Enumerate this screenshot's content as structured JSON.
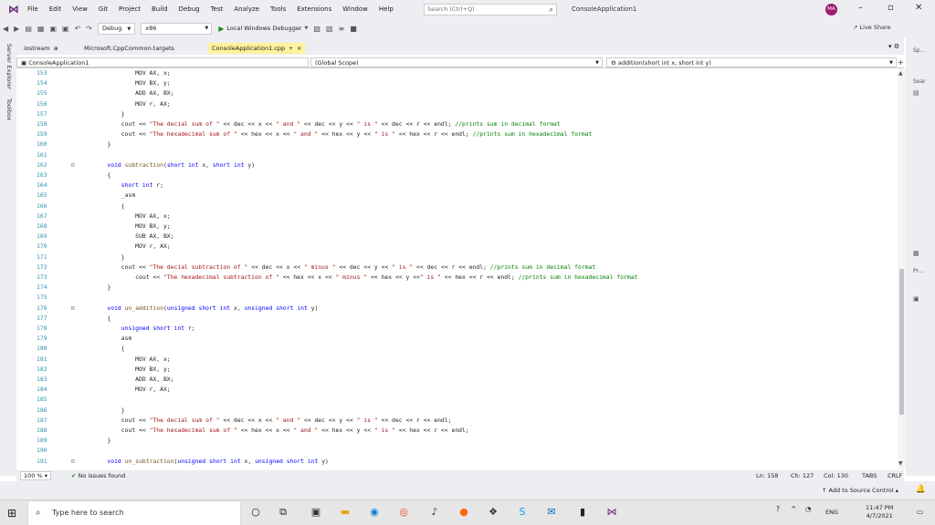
{
  "menu": [
    "File",
    "Edit",
    "View",
    "Git",
    "Project",
    "Build",
    "Debug",
    "Test",
    "Analyze",
    "Tools",
    "Extensions",
    "Window",
    "Help"
  ],
  "search": {
    "placeholder": "Search (Ctrl+Q)"
  },
  "solution_title": "ConsoleApplication1",
  "avatar": "MA",
  "toolbar": {
    "config": "Debug",
    "platform": "x86",
    "debugger": "Local Windows Debugger",
    "live_share": "Live Share"
  },
  "side_tabs": [
    "Server Explorer",
    "Toolbox"
  ],
  "doc_tabs": [
    "iostream",
    "Microsoft.CppCommon.targets",
    "ConsoleApplication1.cpp"
  ],
  "nav": {
    "project": "ConsoleApplication1",
    "scope": "(Global Scope)",
    "member": "addition(short int x, short int y)"
  },
  "right_dock": [
    "Sp...",
    "Sear",
    "Pr..."
  ],
  "code_lines": [
    {
      "n": "153",
      "t": "            MOV AX, x;"
    },
    {
      "n": "154",
      "t": "            MOV BX, y;"
    },
    {
      "n": "155",
      "t": "            ADD AX, BX;"
    },
    {
      "n": "156",
      "t": "            MOV r, AX;"
    },
    {
      "n": "157",
      "t": "        }"
    },
    {
      "n": "158",
      "t": "        cout << \"The decial sum of \" << dec << x << \" and \" << dec << y << \" is \" << dec << r << endl; //prints sum in decimal format"
    },
    {
      "n": "159",
      "t": "        cout << \"The hexadecimal sum of \" << hex << x << \" and \" << hex << y << \" is \" << hex << r << endl; //prints sum in hexadecimal format"
    },
    {
      "n": "160",
      "t": "    }"
    },
    {
      "n": "161",
      "t": ""
    },
    {
      "n": "162",
      "t": "    void subtraction(short int x, short int y)"
    },
    {
      "n": "163",
      "t": "    {"
    },
    {
      "n": "164",
      "t": "        short int r;"
    },
    {
      "n": "165",
      "t": "        _asm"
    },
    {
      "n": "166",
      "t": "        {"
    },
    {
      "n": "167",
      "t": "            MOV AX, x;"
    },
    {
      "n": "168",
      "t": "            MOV BX, y;"
    },
    {
      "n": "169",
      "t": "            SUB AX, BX;"
    },
    {
      "n": "170",
      "t": "            MOV r, AX;"
    },
    {
      "n": "171",
      "t": "        }"
    },
    {
      "n": "172",
      "t": "        cout << \"The decial subtraction of \" << dec << x << \" minus \" << dec << y << \" is \" << dec << r << endl; //prints sum in decimal format"
    },
    {
      "n": "173",
      "t": "            cout << \"The hexadecimal subtraction of \" << hex << x << \" minus \" << hex << y <<\" is \" << hex << r << endl; //prints sum in hexadecimal format"
    },
    {
      "n": "174",
      "t": "    }"
    },
    {
      "n": "175",
      "t": ""
    },
    {
      "n": "176",
      "t": "    void un_addition(unsigned short int x, unsigned short int y)"
    },
    {
      "n": "177",
      "t": "    {"
    },
    {
      "n": "178",
      "t": "        unsigned short int r;"
    },
    {
      "n": "179",
      "t": "        asm"
    },
    {
      "n": "180",
      "t": "        {"
    },
    {
      "n": "181",
      "t": "            MOV AX, x;"
    },
    {
      "n": "182",
      "t": "            MOV BX, y;"
    },
    {
      "n": "183",
      "t": "            ADD AX, BX;"
    },
    {
      "n": "184",
      "t": "            MOV r, AX;"
    },
    {
      "n": "185",
      "t": ""
    },
    {
      "n": "186",
      "t": "        }"
    },
    {
      "n": "187",
      "t": "        cout << \"The decial sum of \" << dec << x << \" and \" << dec << y << \" is \" << dec << r << endl;"
    },
    {
      "n": "188",
      "t": "        cout << \"The hexadecimal sum of \" << hex << x << \" and \" << hex << y << \" is \" << hex << r << endl;"
    },
    {
      "n": "189",
      "t": "    }"
    },
    {
      "n": "190",
      "t": ""
    },
    {
      "n": "191",
      "t": "    void un_subtraction(unsigned short int x, unsigned short int y)"
    }
  ],
  "editor_status": {
    "zoom": "100 %",
    "issues": "No issues found",
    "ln": "Ln: 158",
    "ch": "Ch: 127",
    "col": "Col: 130",
    "tabs": "TABS",
    "crlf": "CRLF"
  },
  "source_control": "Add to Source Control",
  "taskbar": {
    "search_placeholder": "Type here to search",
    "lang": "ENG",
    "time": "11:47 PM",
    "date": "4/7/2021"
  }
}
